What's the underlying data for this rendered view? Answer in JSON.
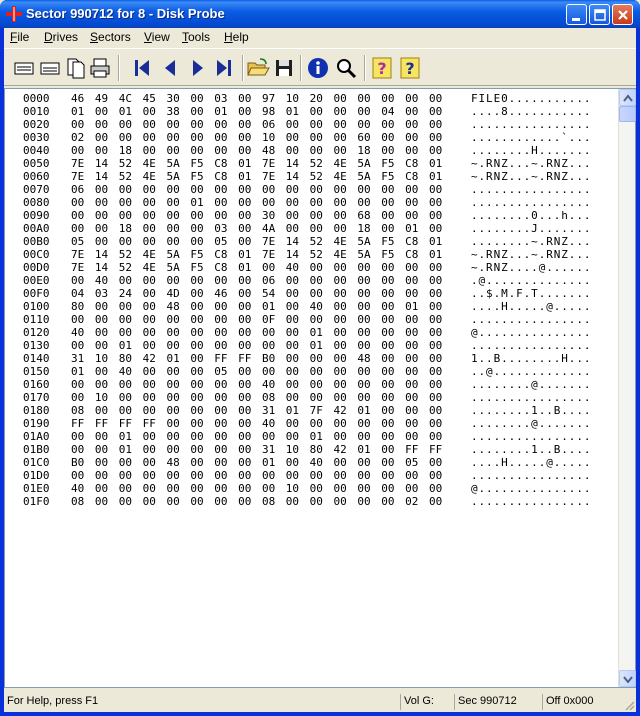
{
  "window": {
    "title": "Sector 990712 for 8 - Disk Probe"
  },
  "menu": [
    {
      "label": "File",
      "ul": "F",
      "rest": "ile"
    },
    {
      "label": "Drives",
      "ul": "D",
      "rest": "rives"
    },
    {
      "label": "Sectors",
      "ul": "S",
      "rest": "ectors"
    },
    {
      "label": "View",
      "ul": "V",
      "rest": "iew"
    },
    {
      "label": "Tools",
      "ul": "T",
      "rest": "ools"
    },
    {
      "label": "Help",
      "ul": "H",
      "rest": "elp"
    }
  ],
  "toolbar": [
    {
      "name": "hex-view-icon"
    },
    {
      "name": "text-view-icon"
    },
    {
      "name": "copy-icon"
    },
    {
      "name": "print-icon"
    },
    {
      "name": "first-sector-icon"
    },
    {
      "name": "prev-sector-icon"
    },
    {
      "name": "next-sector-icon"
    },
    {
      "name": "last-sector-icon"
    },
    {
      "name": "open-folder-icon"
    },
    {
      "name": "save-icon"
    },
    {
      "name": "info-icon"
    },
    {
      "name": "search-icon"
    },
    {
      "name": "help-icon"
    },
    {
      "name": "context-help-icon"
    }
  ],
  "hex_rows": [
    {
      "offset": "0000",
      "bytes": "46 49 4C 45 30 00 03 00 97 10 20 00 00 00 00 00",
      "ascii": "FILE0..........."
    },
    {
      "offset": "0010",
      "bytes": "01 00 01 00 38 00 01 00 98 01 00 00 00 04 00 00",
      "ascii": "....8..........."
    },
    {
      "offset": "0020",
      "bytes": "00 00 00 00 00 00 00 00 06 00 00 00 00 00 00 00",
      "ascii": "................"
    },
    {
      "offset": "0030",
      "bytes": "02 00 00 00 00 00 00 00 10 00 00 00 60 00 00 00",
      "ascii": "............`..."
    },
    {
      "offset": "0040",
      "bytes": "00 00 18 00 00 00 00 00 48 00 00 00 18 00 00 00",
      "ascii": "........H......."
    },
    {
      "offset": "0050",
      "bytes": "7E 14 52 4E 5A F5 C8 01 7E 14 52 4E 5A F5 C8 01",
      "ascii": "~.RNZ...~.RNZ..."
    },
    {
      "offset": "0060",
      "bytes": "7E 14 52 4E 5A F5 C8 01 7E 14 52 4E 5A F5 C8 01",
      "ascii": "~.RNZ...~.RNZ..."
    },
    {
      "offset": "0070",
      "bytes": "06 00 00 00 00 00 00 00 00 00 00 00 00 00 00 00",
      "ascii": "................"
    },
    {
      "offset": "0080",
      "bytes": "00 00 00 00 00 01 00 00 00 00 00 00 00 00 00 00",
      "ascii": "................"
    },
    {
      "offset": "0090",
      "bytes": "00 00 00 00 00 00 00 00 30 00 00 00 68 00 00 00",
      "ascii": "........0...h..."
    },
    {
      "offset": "00A0",
      "bytes": "00 00 18 00 00 00 03 00 4A 00 00 00 18 00 01 00",
      "ascii": "........J......."
    },
    {
      "offset": "00B0",
      "bytes": "05 00 00 00 00 00 05 00 7E 14 52 4E 5A F5 C8 01",
      "ascii": "........~.RNZ..."
    },
    {
      "offset": "00C0",
      "bytes": "7E 14 52 4E 5A F5 C8 01 7E 14 52 4E 5A F5 C8 01",
      "ascii": "~.RNZ...~.RNZ..."
    },
    {
      "offset": "00D0",
      "bytes": "7E 14 52 4E 5A F5 C8 01 00 40 00 00 00 00 00 00",
      "ascii": "~.RNZ....@......"
    },
    {
      "offset": "00E0",
      "bytes": "00 40 00 00 00 00 00 00 06 00 00 00 00 00 00 00",
      "ascii": ".@.............."
    },
    {
      "offset": "00F0",
      "bytes": "04 03 24 00 4D 00 46 00 54 00 00 00 00 00 00 00",
      "ascii": "..$.M.F.T......."
    },
    {
      "offset": "0100",
      "bytes": "80 00 00 00 48 00 00 00 01 00 40 00 00 00 01 00",
      "ascii": "....H.....@....."
    },
    {
      "offset": "0110",
      "bytes": "00 00 00 00 00 00 00 00 0F 00 00 00 00 00 00 00",
      "ascii": "................"
    },
    {
      "offset": "0120",
      "bytes": "40 00 00 00 00 00 00 00 00 00 01 00 00 00 00 00",
      "ascii": "@..............."
    },
    {
      "offset": "0130",
      "bytes": "00 00 01 00 00 00 00 00 00 00 01 00 00 00 00 00",
      "ascii": "................"
    },
    {
      "offset": "0140",
      "bytes": "31 10 80 42 01 00 FF FF B0 00 00 00 48 00 00 00",
      "ascii": "1..B........H..."
    },
    {
      "offset": "0150",
      "bytes": "01 00 40 00 00 00 05 00 00 00 00 00 00 00 00 00",
      "ascii": "..@............."
    },
    {
      "offset": "0160",
      "bytes": "00 00 00 00 00 00 00 00 40 00 00 00 00 00 00 00",
      "ascii": "........@......."
    },
    {
      "offset": "0170",
      "bytes": "00 10 00 00 00 00 00 00 08 00 00 00 00 00 00 00",
      "ascii": "................"
    },
    {
      "offset": "0180",
      "bytes": "08 00 00 00 00 00 00 00 31 01 7F 42 01 00 00 00",
      "ascii": "........1..B...."
    },
    {
      "offset": "0190",
      "bytes": "FF FF FF FF 00 00 00 00 40 00 00 00 00 00 00 00",
      "ascii": "........@......."
    },
    {
      "offset": "01A0",
      "bytes": "00 00 01 00 00 00 00 00 00 00 01 00 00 00 00 00",
      "ascii": "................"
    },
    {
      "offset": "01B0",
      "bytes": "00 00 01 00 00 00 00 00 31 10 80 42 01 00 FF FF",
      "ascii": "........1..B...."
    },
    {
      "offset": "01C0",
      "bytes": "B0 00 00 00 48 00 00 00 01 00 40 00 00 00 05 00",
      "ascii": "....H.....@....."
    },
    {
      "offset": "01D0",
      "bytes": "00 00 00 00 00 00 00 00 00 00 00 00 00 00 00 00",
      "ascii": "................"
    },
    {
      "offset": "01E0",
      "bytes": "40 00 00 00 00 00 00 00 00 10 00 00 00 00 00 00",
      "ascii": "@..............."
    },
    {
      "offset": "01F0",
      "bytes": "08 00 00 00 00 00 00 00 08 00 00 00 00 00 02 00",
      "ascii": "................"
    }
  ],
  "status": {
    "help": "For Help, press F1",
    "volume": "Vol G:",
    "sector": "Sec 990712",
    "offset": "Off 0x000"
  },
  "colors": {
    "titlebar": "#0A5DE3",
    "face": "#ECE9D8",
    "nav_arrow": "#1A2E9A",
    "help_magenta": "#B02AA6"
  }
}
